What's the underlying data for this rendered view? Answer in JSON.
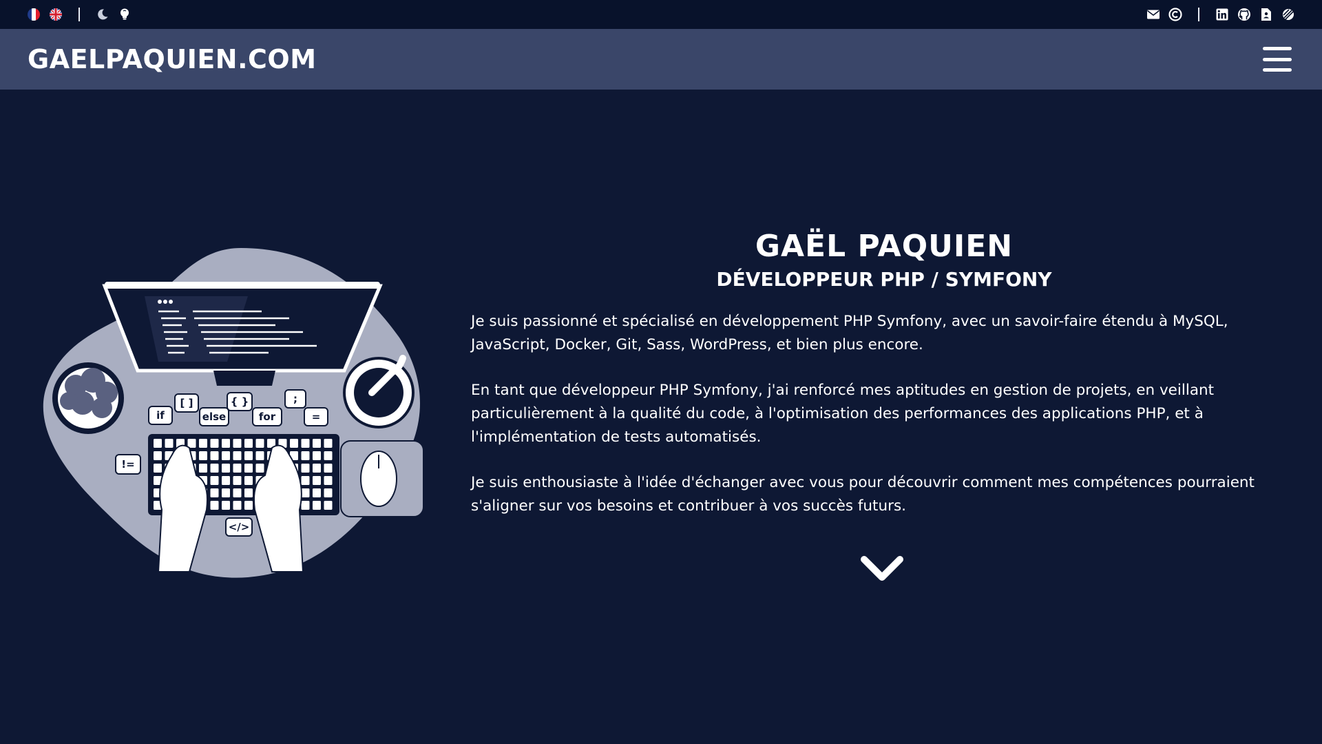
{
  "topbar": {
    "left_icons": [
      "flag-france-icon",
      "flag-uk-icon",
      "moon-icon",
      "lightbulb-icon"
    ],
    "right_icons": [
      "envelope-icon",
      "copyright-icon",
      "linkedin-icon",
      "github-icon",
      "cv-document-icon",
      "codingame-icon"
    ]
  },
  "header": {
    "brand": "GAELPAQUIEN.COM"
  },
  "hero": {
    "name": "GAËL PAQUIEN",
    "subtitle": "DÉVELOPPEUR PHP / SYMFONY",
    "paragraphs": [
      "Je suis passionné et spécialisé en développement PHP Symfony, avec un savoir-faire étendu à MySQL, JavaScript, Docker, Git, Sass, WordPress, et bien plus encore.",
      "En tant que développeur PHP Symfony, j'ai renforcé mes aptitudes en gestion de projets, en veillant particulièrement à la qualité du code, à l'optimisation des performances des applications PHP, et à l'implémentation de tests automatisés.",
      "Je suis enthousiaste à l'idée d'échanger avec vous pour découvrir comment mes compétences pourraient s'aligner sur vos besoins et contribuer à vos succès futurs."
    ],
    "illustration_bubbles": [
      "[ ]",
      "{ }",
      ";",
      "if",
      "else",
      "for",
      "=",
      "!=",
      "</>"
    ]
  },
  "colors": {
    "background": "#0e1834",
    "topbar": "#08122b",
    "header": "#3a4669",
    "text": "#ffffff",
    "illustration_blob": "#a9aec1"
  }
}
